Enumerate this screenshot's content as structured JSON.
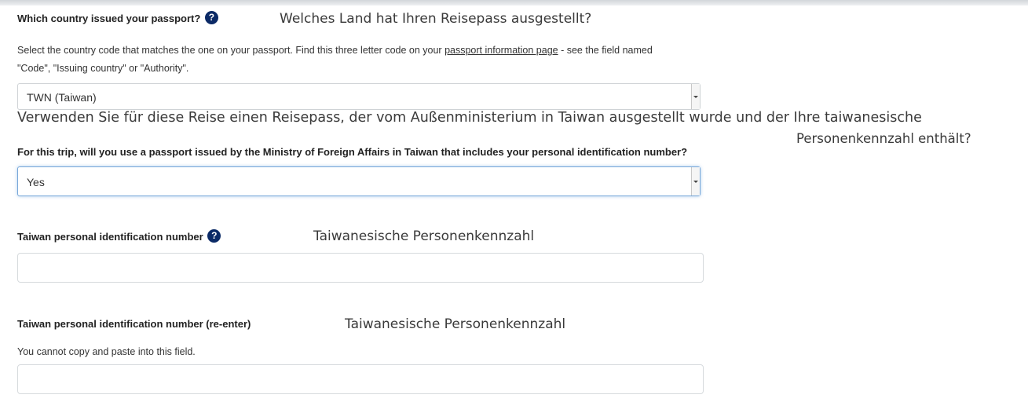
{
  "country_question": {
    "label": "Which country issued your passport?",
    "help_icon": "question-circle-icon",
    "translation": "Welches Land hat Ihren Reisepass ausgestellt?",
    "help_text_1": "Select the country code that matches the one on your passport.  Find this three letter code on your",
    "help_link": "passport information page",
    "help_text_2": "- see the field named",
    "help_text_3": "\"Code\", \"Issuing country\" or \"Authority\".",
    "selected_value": "TWN (Taiwan)"
  },
  "mofa_question": {
    "translation_line_1": "Verwenden Sie für diese Reise einen Reisepass, der vom Außenministerium in Taiwan ausgestellt wurde und der Ihre taiwanesische",
    "translation_line_2": "Personenkennzahl enthält?",
    "label": "For this trip, will you use a passport issued by the Ministry of Foreign Affairs in Taiwan that includes your personal identification number?",
    "selected_value": "Yes"
  },
  "id_number": {
    "label": "Taiwan personal identification number",
    "help_icon": "question-circle-icon",
    "translation": "Taiwanesische Personenkennzahl",
    "value": ""
  },
  "id_number_reenter": {
    "label": "Taiwan personal identification number (re-enter)",
    "translation": "Taiwanesische Personenkennzahl",
    "note": "You cannot copy and paste into this field.",
    "value": ""
  },
  "colors": {
    "help_icon": "#0b2a66",
    "focus_border": "#76a6d8"
  }
}
